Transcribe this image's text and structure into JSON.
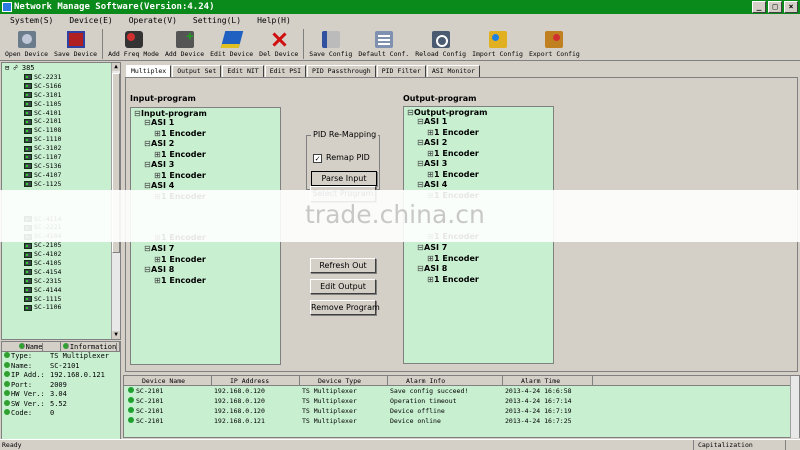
{
  "window": {
    "title": "Network Manage Software(Version:4.24)"
  },
  "menu": [
    "System(S)",
    "Device(E)",
    "Operate(V)",
    "Setting(L)",
    "Help(H)"
  ],
  "toolbar": [
    {
      "label": "Open Device",
      "icon": "open-device-icon"
    },
    {
      "label": "Save Device",
      "icon": "save-device-icon"
    },
    {
      "label": "Add Freq Mode",
      "icon": "add-freq-mode-icon"
    },
    {
      "label": "Add Device",
      "icon": "add-device-icon"
    },
    {
      "label": "Edit Device",
      "icon": "edit-device-icon"
    },
    {
      "label": "Del Device",
      "icon": "delete-device-icon"
    },
    {
      "label": "Save Config",
      "icon": "save-config-icon"
    },
    {
      "label": "Default Conf.",
      "icon": "default-config-icon"
    },
    {
      "label": "Reload Config",
      "icon": "reload-config-icon"
    },
    {
      "label": "Import Config",
      "icon": "import-config-icon"
    },
    {
      "label": "Export Config",
      "icon": "export-config-icon"
    }
  ],
  "tree": {
    "root": "385",
    "items": [
      "SC-2231",
      "SC-5166",
      "SC-3101",
      "SC-1105",
      "SC-4101",
      "SC-2101",
      "SC-1108",
      "SC-1110",
      "SC-3102",
      "SC-1107",
      "SC-5136",
      "SC-4107",
      "SC-1125",
      "SC-4114",
      "SC-2221",
      "SC-4104",
      "SC-2105",
      "SC-4102",
      "SC-4105",
      "SC-4154",
      "SC-2315",
      "SC-4144",
      "SC-1115",
      "SC-1106"
    ]
  },
  "info": {
    "headers": [
      "Name",
      "Information"
    ],
    "rows": [
      {
        "k": "Type:",
        "v": "TS Multiplexer"
      },
      {
        "k": "Name:",
        "v": "SC-2101"
      },
      {
        "k": "IP Add.:",
        "v": "192.168.0.121"
      },
      {
        "k": "Port:",
        "v": "2009"
      },
      {
        "k": "HW Ver.:",
        "v": "3.04"
      },
      {
        "k": "SW Ver.:",
        "v": "5.52"
      },
      {
        "k": "Code:",
        "v": "0"
      }
    ]
  },
  "tabs": [
    "Multiplex",
    "Output Set",
    "Edit NIT",
    "Edit PSI",
    "PID Passthrough",
    "PID Filter",
    "ASI Monitor"
  ],
  "input": {
    "title": "Input-program",
    "root": "Input-program",
    "channels": [
      {
        "asi": "ASI 1",
        "enc": "1 Encoder"
      },
      {
        "asi": "ASI 2",
        "enc": "1 Encoder"
      },
      {
        "asi": "ASI 3",
        "enc": "1 Encoder"
      },
      {
        "asi": "ASI 4",
        "enc": "1 Encoder"
      },
      {
        "asi": "",
        "enc": "1 Encoder"
      },
      {
        "asi": "ASI 7",
        "enc": "1 Encoder"
      },
      {
        "asi": "ASI 8",
        "enc": "1 Encoder"
      }
    ]
  },
  "output": {
    "title": "Output-program",
    "root": "Output-program",
    "channels": [
      {
        "asi": "ASI 1",
        "enc": "1 Encoder"
      },
      {
        "asi": "ASI 2",
        "enc": "1 Encoder"
      },
      {
        "asi": "ASI 3",
        "enc": "1 Encoder"
      },
      {
        "asi": "ASI 4",
        "enc": "1 Encoder"
      },
      {
        "asi": "",
        "enc": "1 Encoder"
      },
      {
        "asi": "ASI 7",
        "enc": "1 Encoder"
      },
      {
        "asi": "ASI 8",
        "enc": "1 Encoder"
      }
    ]
  },
  "remap": {
    "group_title": "PID Re-Mapping",
    "checkbox_label": "Remap PID",
    "checked": true,
    "parse_button": "Parse Input"
  },
  "buttons": {
    "select_program": "Select Program",
    "refresh_out": "Refresh Out",
    "edit_output": "Edit Output",
    "remove_program": "Remove Program"
  },
  "watermark": "trade.china.cn",
  "alarms": {
    "headers": [
      "Device Name",
      "IP Address",
      "Device Type",
      "Alarm Info",
      "Alarm Time"
    ],
    "rows": [
      [
        "SC-2101",
        "192.168.0.120",
        "TS Multiplexer",
        "Save config succeed!",
        "2013-4-24 16:6:58"
      ],
      [
        "SC-2101",
        "192.168.0.120",
        "TS Multiplexer",
        "Operation timeout",
        "2013-4-24 16:7:14"
      ],
      [
        "SC-2101",
        "192.168.0.120",
        "TS Multiplexer",
        "Device offline",
        "2013-4-24 16:7:19"
      ],
      [
        "SC-2101",
        "192.168.0.121",
        "TS Multiplexer",
        "Device online",
        "2013-4-24 16:7:25"
      ]
    ]
  },
  "status": {
    "left": "Ready",
    "right": "Capitalization"
  }
}
